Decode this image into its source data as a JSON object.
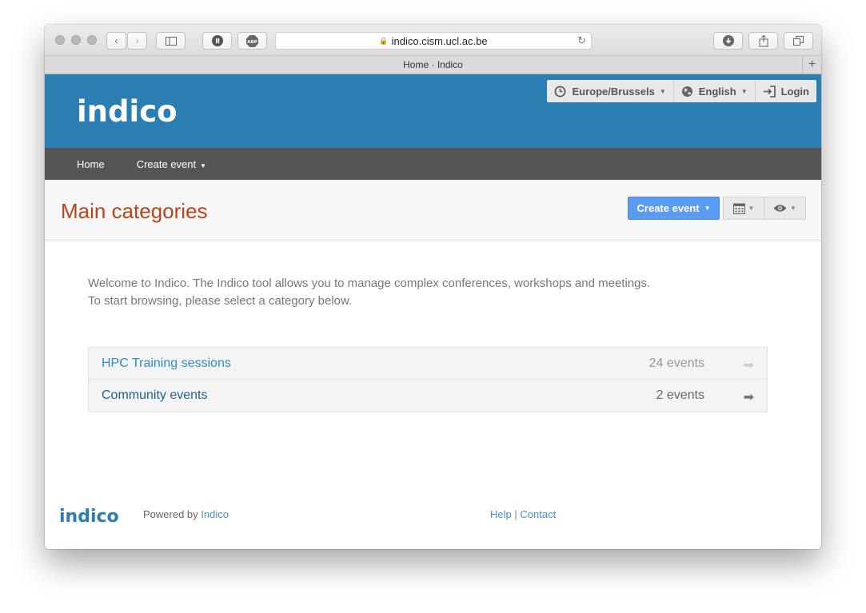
{
  "browser": {
    "url": "indico.cism.ucl.ac.be",
    "tab_title": "Home · Indico",
    "tab_plus": "+"
  },
  "header": {
    "logo_text": "indico",
    "timezone": "Europe/Brussels",
    "language": "English",
    "login": "Login"
  },
  "nav": {
    "home": "Home",
    "create_event": "Create event"
  },
  "page": {
    "title": "Main categories",
    "create_event_button": "Create event",
    "welcome_line1": "Welcome to Indico. The Indico tool allows you to manage complex conferences, workshops and meetings.",
    "welcome_line2": "To start browsing, please select a category below."
  },
  "categories": [
    {
      "name": "HPC Training sessions",
      "count": "24 events",
      "name_color": "#2d8cc7",
      "count_color": "#999999",
      "arrow_color": "#cccccc"
    },
    {
      "name": "Community events",
      "count": "2 events",
      "name_color": "#1f5f8a",
      "count_color": "#666666",
      "arrow_color": "#777777"
    }
  ],
  "footer": {
    "powered_by": "Powered by",
    "powered_link": "Indico",
    "help": "Help",
    "separator": "|",
    "contact": "Contact"
  },
  "colors": {
    "brand_blue": "#2b7eb3",
    "nav_grey": "#555555",
    "title_orange": "#b5451b",
    "button_blue": "#5b9bf2"
  }
}
